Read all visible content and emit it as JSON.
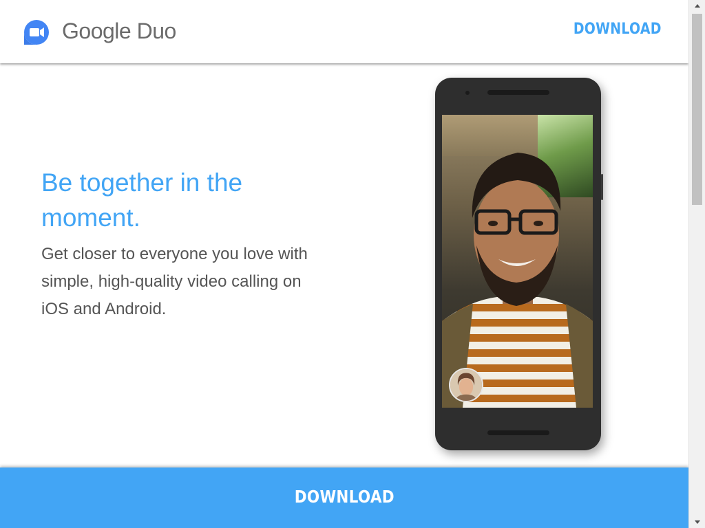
{
  "header": {
    "brand_name": "Google Duo",
    "logo_icon": "google-duo-camera-icon",
    "download_label": "DOWNLOAD"
  },
  "hero": {
    "headline": "Be together in the moment.",
    "subtext": "Get closer to everyone you love with simple, high-quality video calling on iOS and Android."
  },
  "phone": {
    "screen_content": "video-call-selfie",
    "pip_content": "self-view-thumbnail"
  },
  "bottom_bar": {
    "download_label": "DOWNLOAD"
  },
  "colors": {
    "accent": "#42a5f5",
    "text_body": "#555555",
    "brand_text": "#6b6b6b"
  }
}
